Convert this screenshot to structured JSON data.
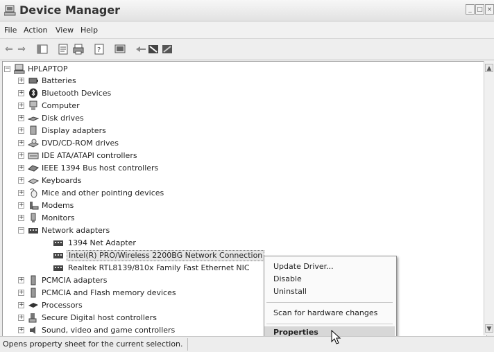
{
  "window": {
    "title": "Device Manager"
  },
  "menu": [
    "File",
    "Action",
    "View",
    "Help"
  ],
  "tree": {
    "root": "HPLAPTOP",
    "items": [
      {
        "label": "Batteries",
        "expanded": false
      },
      {
        "label": "Bluetooth Devices",
        "expanded": false
      },
      {
        "label": "Computer",
        "expanded": false
      },
      {
        "label": "Disk drives",
        "expanded": false
      },
      {
        "label": "Display adapters",
        "expanded": false
      },
      {
        "label": "DVD/CD-ROM drives",
        "expanded": false
      },
      {
        "label": "IDE ATA/ATAPI controllers",
        "expanded": false
      },
      {
        "label": "IEEE 1394 Bus host controllers",
        "expanded": false
      },
      {
        "label": "Keyboards",
        "expanded": false
      },
      {
        "label": "Mice and other pointing devices",
        "expanded": false
      },
      {
        "label": "Modems",
        "expanded": false
      },
      {
        "label": "Monitors",
        "expanded": false
      },
      {
        "label": "Network adapters",
        "expanded": true,
        "children": [
          "1394 Net Adapter",
          "Intel(R) PRO/Wireless 2200BG Network Connection",
          "Realtek RTL8139/810x Family Fast Ethernet NIC"
        ]
      },
      {
        "label": "PCMCIA adapters",
        "expanded": false
      },
      {
        "label": "PCMCIA and Flash memory devices",
        "expanded": false
      },
      {
        "label": "Processors",
        "expanded": false
      },
      {
        "label": "Secure Digital host controllers",
        "expanded": false
      },
      {
        "label": "Sound, video and game controllers",
        "expanded": false
      }
    ]
  },
  "context_menu": {
    "update_driver": "Update Driver...",
    "disable": "Disable",
    "uninstall": "Uninstall",
    "scan": "Scan for hardware changes",
    "properties": "Properties"
  },
  "status": "Opens property sheet for the current selection."
}
